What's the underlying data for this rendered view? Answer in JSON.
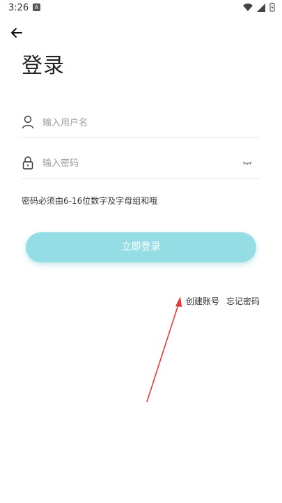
{
  "status_bar": {
    "time": "3:26",
    "notification_icon": "a-badge-icon",
    "icons": [
      "wifi-icon",
      "signal-icon",
      "battery-charging-icon"
    ]
  },
  "header": {
    "back_icon": "arrow-left-icon",
    "title": "登录"
  },
  "form": {
    "username": {
      "icon": "user-icon",
      "placeholder": "输入用户名",
      "value": ""
    },
    "password": {
      "icon": "lock-icon",
      "placeholder": "输入密码",
      "value": "",
      "toggle_icon": "eye-closed-icon"
    },
    "hint": "密码必须由6-16位数字及字母组和哦",
    "submit_label": "立即登录"
  },
  "links": {
    "create_account": "创建账号",
    "forgot_password": "忘记密码"
  },
  "annotation": {
    "icon": "red-arrow-icon",
    "color": "#e53935"
  },
  "colors": {
    "accent": "#95dde5",
    "text": "#222222",
    "placeholder": "#999999"
  }
}
